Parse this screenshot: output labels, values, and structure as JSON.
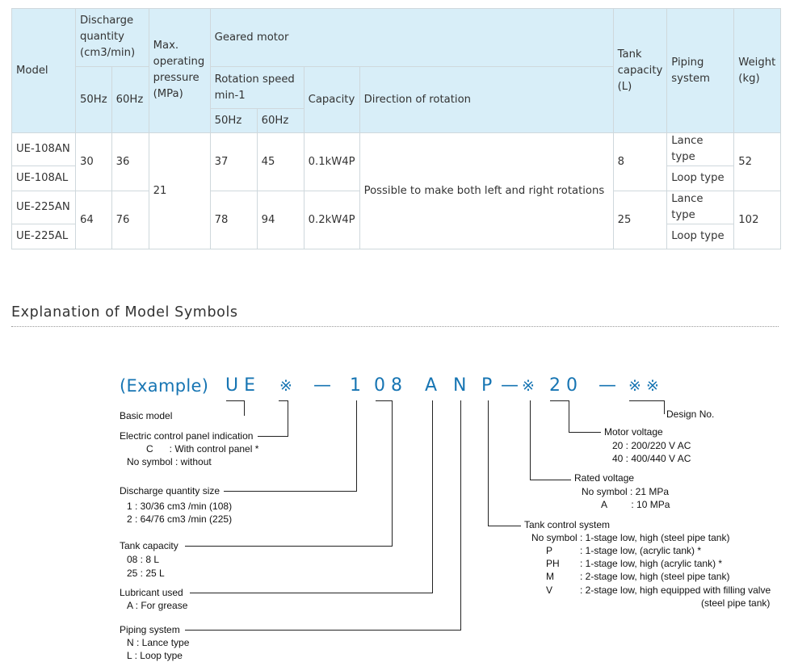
{
  "table": {
    "headers": {
      "model": "Model",
      "discharge": "Discharge quantity (cm3/min)",
      "hz50": "50Hz",
      "hz60": "60Hz",
      "max_pressure": "Max. operating pressure (MPa)",
      "geared_motor": "Geared motor",
      "rotation_speed": "Rotation speed min-1",
      "capacity": "Capacity",
      "direction": "Direction of rotation",
      "tank": "Tank capacity (L)",
      "piping": "Piping system",
      "weight": "Weight (kg)"
    },
    "rows": [
      {
        "model": "UE-108AN",
        "piping": "Lance type"
      },
      {
        "model": "UE-108AL",
        "piping": "Loop type"
      },
      {
        "model": "UE-225AN",
        "piping": "Lance type"
      },
      {
        "model": "UE-225AL",
        "piping": "Loop type"
      }
    ],
    "groups": [
      {
        "d50": "30",
        "d60": "36",
        "r50": "37",
        "r60": "45",
        "capacity": "0.1kW4P",
        "tank": "8",
        "weight": "52"
      },
      {
        "d50": "64",
        "d60": "76",
        "r50": "78",
        "r60": "94",
        "capacity": "0.2kW4P",
        "tank": "25",
        "weight": "102"
      }
    ],
    "pressure": "21",
    "direction": "Possible to make both left and right rotations"
  },
  "section_title": "Explanation of Model Symbols",
  "model_code": {
    "example": "(Example)",
    "parts": [
      "U E",
      "※",
      "—",
      "1",
      "0 8",
      "A",
      "N",
      "P",
      "—",
      "※",
      "2 0",
      "—",
      "※ ※"
    ]
  },
  "labels": {
    "basic_model": "Basic model",
    "ecp": "Electric control panel indication",
    "ecp_c": "C      : With control panel *",
    "ecp_none": "No symbol : without",
    "discharge": "Discharge quantity size",
    "discharge_1": "1 : 30/36 cm3 /min (108)",
    "discharge_2": "2 : 64/76 cm3 /min (225)",
    "tank": "Tank capacity",
    "tank_08": "08 : 8 L",
    "tank_25": "25 : 25 L",
    "lubricant": "Lubricant used",
    "lubricant_a": "A : For grease",
    "piping": "Piping system",
    "piping_n": "N : Lance type",
    "piping_l": "L : Loop type",
    "design": "Design No.",
    "motor": "Motor voltage",
    "motor_20": "20 : 200/220 V AC",
    "motor_40": "40 : 400/440 V AC",
    "rated": "Rated voltage",
    "rated_none": "No symbol : 21 MPa",
    "rated_a": "A         : 10 MPa",
    "tcs": "Tank control system",
    "tcs_none": "No symbol : 1-stage low, high (steel pipe tank)",
    "tcs_p_key": "P",
    "tcs_p": ": 1-stage low, (acrylic tank) *",
    "tcs_ph_key": "PH",
    "tcs_ph": ": 1-stage low, high (acrylic tank) *",
    "tcs_m_key": "M",
    "tcs_m": ": 2-stage low, high (steel pipe tank)",
    "tcs_v_key": "V",
    "tcs_v": ": 2-stage low, high equipped with filling valve",
    "tcs_v2": "(steel pipe tank)"
  }
}
